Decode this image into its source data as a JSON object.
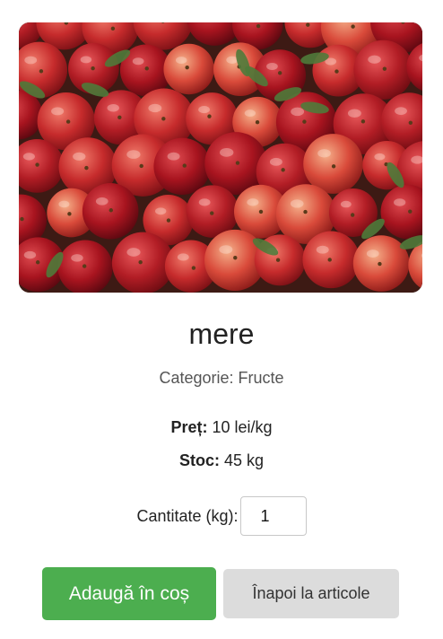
{
  "product": {
    "name": "mere",
    "image_subject": "pile of red apples with leaves",
    "category_label": "Categorie:",
    "category_value": "Fructe",
    "price_label": "Preț:",
    "price_value": "10 lei/kg",
    "stock_label": "Stoc:",
    "stock_value": "45 kg"
  },
  "quantity": {
    "label": "Cantitate (kg):",
    "value": "1"
  },
  "actions": {
    "add_to_cart": "Adaugă în coș",
    "back_to_items": "Înapoi la articole"
  },
  "colors": {
    "add_button": "#4cae4f",
    "back_button": "#dcdcdc"
  }
}
